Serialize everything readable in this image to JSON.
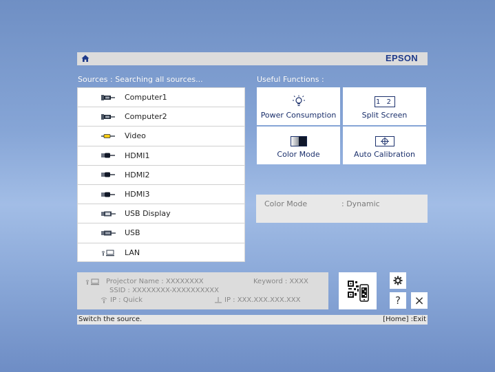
{
  "header": {
    "brand": "EPSON",
    "home_icon": "home-icon"
  },
  "sources": {
    "label": "Sources : Searching all sources...",
    "items": [
      {
        "label": "Computer1",
        "icon": "vga-connector-icon"
      },
      {
        "label": "Computer2",
        "icon": "vga-connector-icon"
      },
      {
        "label": "Video",
        "icon": "rca-connector-icon"
      },
      {
        "label": "HDMI1",
        "icon": "hdmi-connector-icon"
      },
      {
        "label": "HDMI2",
        "icon": "hdmi-connector-icon"
      },
      {
        "label": "HDMI3",
        "icon": "hdmi-connector-icon"
      },
      {
        "label": "USB Display",
        "icon": "usb-display-icon"
      },
      {
        "label": "USB",
        "icon": "usb-icon"
      },
      {
        "label": "LAN",
        "icon": "lan-icon"
      }
    ]
  },
  "functions": {
    "label": "Useful Functions :",
    "power": "Power Consumption",
    "split": "Split Screen",
    "split_icon_text": "1 2",
    "color": "Color Mode",
    "autocal": "Auto Calibration"
  },
  "info": {
    "key": "Color Mode",
    "value": ": Dynamic"
  },
  "network": {
    "projector_name": "Projector Name : XXXXXXXX",
    "keyword": "Keyword : XXXX",
    "ssid": "SSID : XXXXXXXX-XXXXXXXXXX",
    "ip_quick": "IP : Quick",
    "ip_wired": "IP : XXX.XXX.XXX.XXX"
  },
  "buttons": {
    "help": "?",
    "close": "×"
  },
  "status": {
    "hint": "Switch the source.",
    "exit": "[Home] :Exit"
  }
}
